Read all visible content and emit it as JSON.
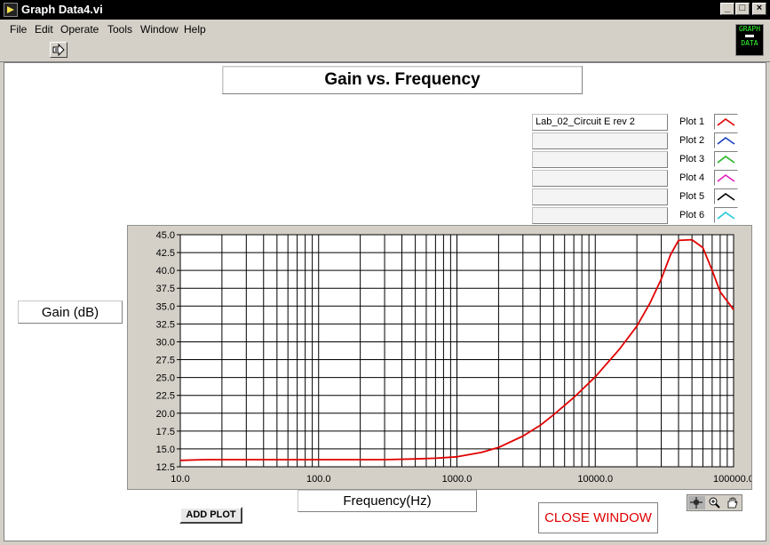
{
  "window": {
    "title": "Graph Data4.vi",
    "min_label": "_",
    "max_label": "□",
    "close_label": "×"
  },
  "menu": [
    "File",
    "Edit",
    "Operate",
    "Tools",
    "Window",
    "Help"
  ],
  "logo": {
    "line1": "GRAPH",
    "line2": "DATA"
  },
  "graph_title": "Gain vs. Frequency",
  "legend": {
    "fields": [
      "Lab_02_Circuit E rev 2",
      "",
      "",
      "",
      "",
      ""
    ],
    "plots": [
      {
        "label": "Plot 1",
        "color": "#e00000"
      },
      {
        "label": "Plot 2",
        "color": "#1a3fbf"
      },
      {
        "label": "Plot 3",
        "color": "#22b422"
      },
      {
        "label": "Plot 4",
        "color": "#e020c0"
      },
      {
        "label": "Plot 5",
        "color": "#000000"
      },
      {
        "label": "Plot 6",
        "color": "#20c8d8"
      }
    ]
  },
  "y_axis_label": "Gain (dB)",
  "x_axis_label": "Frequency(Hz)",
  "buttons": {
    "add_plot": "ADD PLOT",
    "close_window": "CLOSE WINDOW"
  },
  "chart_data": {
    "type": "line",
    "title": "Gain vs. Frequency",
    "xlabel": "Frequency(Hz)",
    "ylabel": "Gain (dB)",
    "xscale": "log",
    "xlim": [
      10,
      100000
    ],
    "ylim": [
      12.5,
      45.0
    ],
    "grid": true,
    "x_tick_labels": [
      "10.0",
      "100.0",
      "1000.0",
      "10000.0",
      "100000.0"
    ],
    "y_tick_labels": [
      "12.5",
      "15.0",
      "17.5",
      "20.0",
      "22.5",
      "25.0",
      "27.5",
      "30.0",
      "32.5",
      "35.0",
      "37.5",
      "40.0",
      "42.5",
      "45.0"
    ],
    "series": [
      {
        "name": "Lab_02_Circuit E rev 2",
        "color": "#e00000",
        "x": [
          10,
          15,
          30,
          100,
          300,
          500,
          700,
          1000,
          1500,
          2000,
          3000,
          4000,
          5000,
          7000,
          10000,
          15000,
          20000,
          25000,
          30000,
          35000,
          40000,
          50000,
          60000,
          70000,
          80000,
          100000
        ],
        "y": [
          13.4,
          13.5,
          13.5,
          13.5,
          13.5,
          13.6,
          13.7,
          13.9,
          14.5,
          15.2,
          16.8,
          18.3,
          19.8,
          22.2,
          25.1,
          29.0,
          32.2,
          35.5,
          38.8,
          42.2,
          44.2,
          44.3,
          43.2,
          40.0,
          37.0,
          34.5
        ]
      }
    ]
  }
}
